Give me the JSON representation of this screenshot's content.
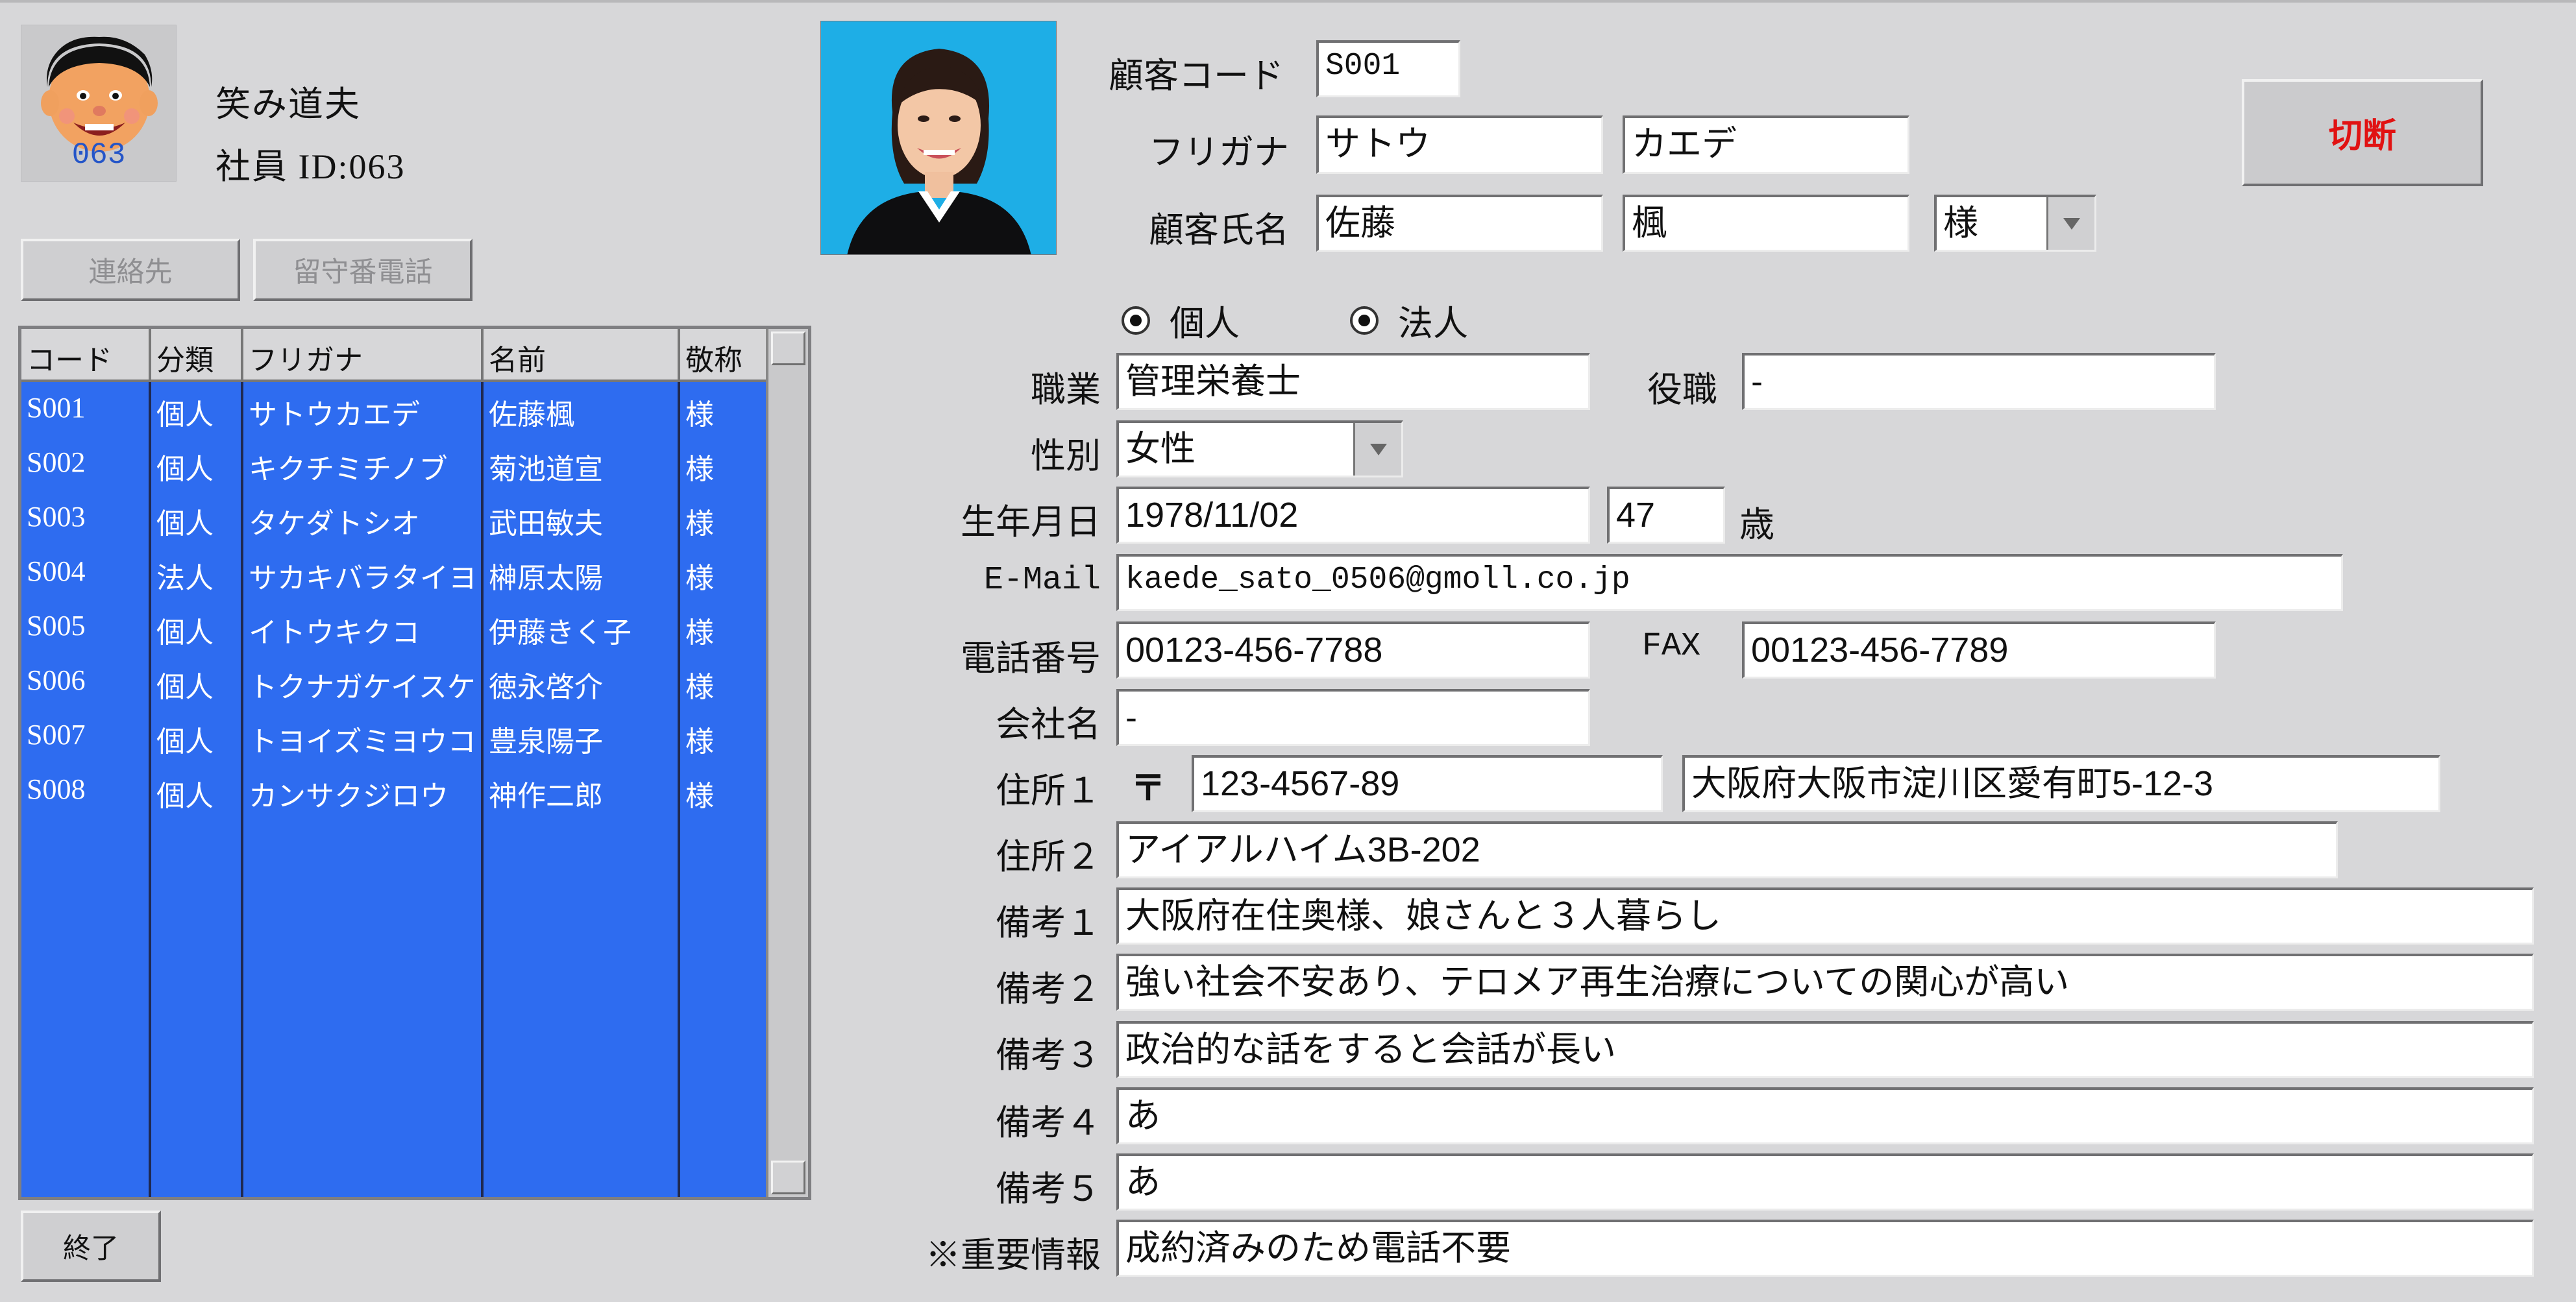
{
  "user": {
    "name": "笑み道夫",
    "id_label": "社員 ID:063",
    "avatar_number": "063"
  },
  "left_buttons": {
    "contacts": "連絡先",
    "voicemail": "留守番電話",
    "exit": "終了"
  },
  "customer_list": {
    "headers": [
      "コード",
      "分類",
      "フリガナ",
      "名前",
      "敬称"
    ],
    "rows": [
      [
        "S001",
        "個人",
        "サトウカエデ",
        "佐藤楓",
        "様"
      ],
      [
        "S002",
        "個人",
        "キクチミチノブ",
        "菊池道宣",
        "様"
      ],
      [
        "S003",
        "個人",
        "タケダトシオ",
        "武田敏夫",
        "様"
      ],
      [
        "S004",
        "法人",
        "サカキバラタイヨ",
        "榊原太陽",
        "様"
      ],
      [
        "S005",
        "個人",
        "イトウキクコ",
        "伊藤きく子",
        "様"
      ],
      [
        "S006",
        "個人",
        "トクナガケイスケ",
        "徳永啓介",
        "様"
      ],
      [
        "S007",
        "個人",
        "トヨイズミヨウコ",
        "豊泉陽子",
        "様"
      ],
      [
        "S008",
        "個人",
        "カンサクジロウ",
        "神作二郎",
        "様"
      ]
    ]
  },
  "disconnect_button": "切断",
  "form": {
    "customer_code_label": "顧客コード",
    "customer_code": "S001",
    "furigana_label": "フリガナ",
    "furigana_last": "サトウ",
    "furigana_first": "カエデ",
    "customer_name_label": "顧客氏名",
    "name_last": "佐藤",
    "name_first": "楓",
    "honorific": "様",
    "type_individual": "個人",
    "type_corporate": "法人",
    "type_selected": "個人",
    "occupation_label": "職業",
    "occupation": "管理栄養士",
    "position_label": "役職",
    "position": "-",
    "gender_label": "性別",
    "gender": "女性",
    "birthdate_label": "生年月日",
    "birthdate": "1978/11/02",
    "age": "47",
    "age_unit": "歳",
    "email_label": "E-Mail",
    "email": "kaede_sato_0506@gmoll.co.jp",
    "phone_label": "電話番号",
    "phone": "00123-456-7788",
    "fax_label": "FAX",
    "fax": "00123-456-7789",
    "company_label": "会社名",
    "company": "-",
    "address1_label": "住所１",
    "postal_mark": "〒",
    "postal_code": "123-4567-89",
    "address1": "大阪府大阪市淀川区愛有町5-12-3",
    "address2_label": "住所２",
    "address2": "アイアルハイム3B-202",
    "note1_label": "備考１",
    "note1": "大阪府在住奥様、娘さんと３人暮らし",
    "note2_label": "備考２",
    "note2": "強い社会不安あり、テロメア再生治療についての関心が高い",
    "note3_label": "備考３",
    "note3": "政治的な話をすると会話が長い",
    "note4_label": "備考４",
    "note4": "あ",
    "note5_label": "備考５",
    "note5": "あ",
    "important_label": "※重要情報",
    "important": "成約済みのため電話不要"
  },
  "colors": {
    "background": "#d7d7d9",
    "list_selection": "#2e6cf0",
    "disconnect_text": "#e11212",
    "avatar_id": "#2455c8",
    "photo_background": "#22b0e6"
  }
}
